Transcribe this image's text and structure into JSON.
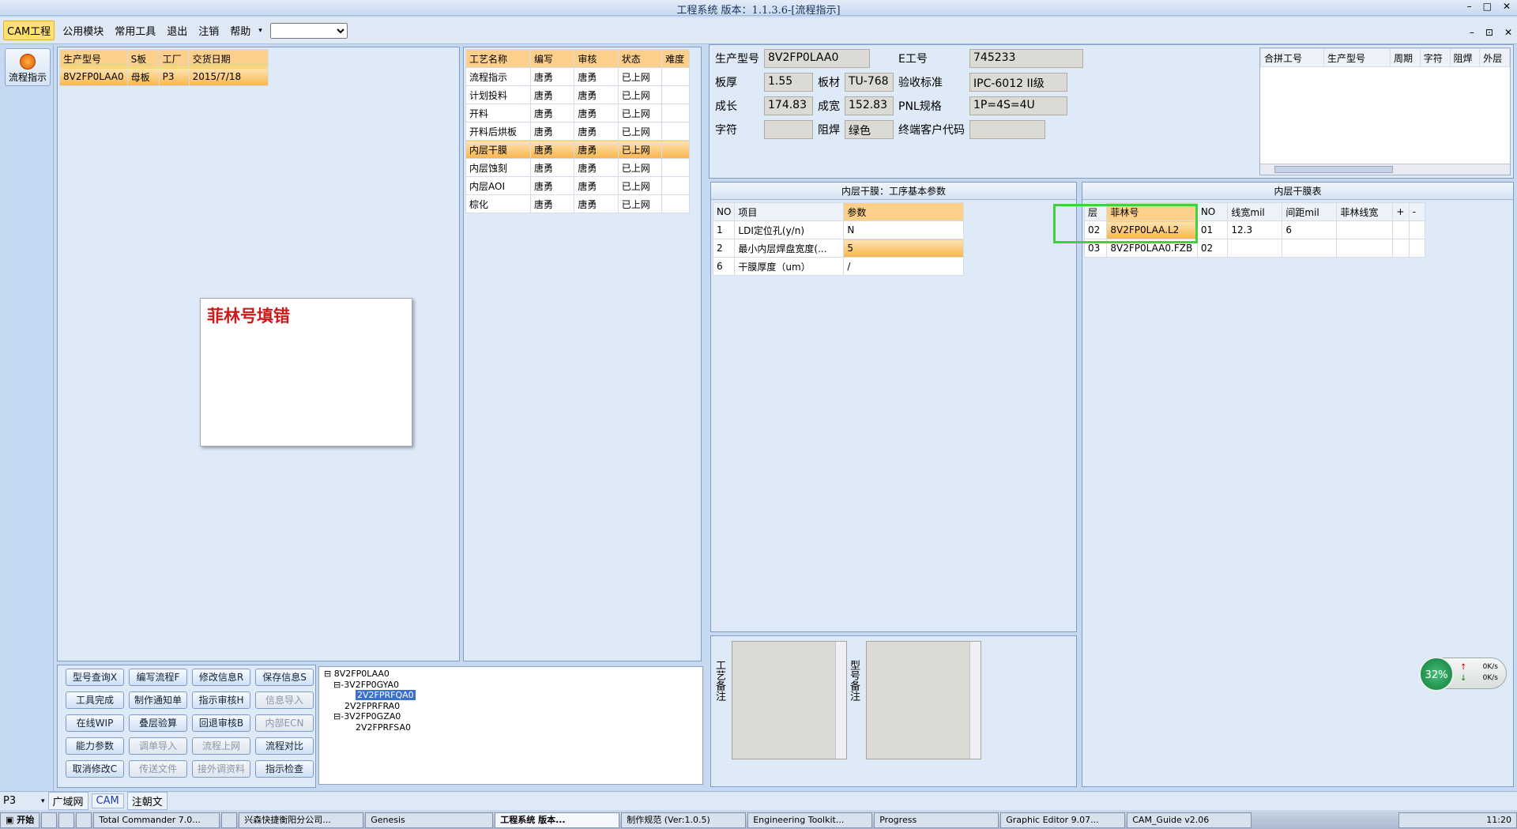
{
  "window": {
    "title": "工程系统  版本：1.1.3.6-[流程指示]",
    "controls": [
      "–",
      "□",
      "✕"
    ]
  },
  "menu": {
    "items": [
      "CAM工程",
      "公用模块",
      "常用工具",
      "退出",
      "注销",
      "帮助"
    ],
    "right": [
      "–",
      "⊡",
      "✕"
    ]
  },
  "side": {
    "flow_label": "流程指示"
  },
  "product_table": {
    "columns": [
      "生产型号",
      "S板",
      "工厂",
      "交货日期"
    ],
    "rows": [
      [
        "8V2FP0LAA0",
        "母板",
        "P3",
        "2015/7/18"
      ]
    ]
  },
  "popup": {
    "message": "菲林号填错"
  },
  "process_table": {
    "columns": [
      "工艺名称",
      "编写",
      "审核",
      "状态",
      "难度"
    ],
    "rows": [
      [
        "流程指示",
        "唐勇",
        "唐勇",
        "已上网",
        ""
      ],
      [
        "计划投料",
        "唐勇",
        "唐勇",
        "已上网",
        ""
      ],
      [
        "开料",
        "唐勇",
        "唐勇",
        "已上网",
        ""
      ],
      [
        "开料后烘板",
        "唐勇",
        "唐勇",
        "已上网",
        ""
      ],
      [
        "内层干膜",
        "唐勇",
        "唐勇",
        "已上网",
        ""
      ],
      [
        "内层蚀刻",
        "唐勇",
        "唐勇",
        "已上网",
        ""
      ],
      [
        "内层AOI",
        "唐勇",
        "唐勇",
        "已上网",
        ""
      ],
      [
        "棕化",
        "唐勇",
        "唐勇",
        "已上网",
        ""
      ]
    ]
  },
  "info": {
    "prod_label": "生产型号",
    "prod_value": "8V2FP0LAA0",
    "e_label": "E工号",
    "e_value": "745233",
    "thick_label": "板厚",
    "thick_value": "1.55",
    "mat_label": "板材",
    "mat_value": "TU-768",
    "std_label": "验收标准",
    "std_value": "IPC-6012 II级",
    "len_label": "成长",
    "len_value": "174.83",
    "wid_label": "成宽",
    "wid_value": "152.83",
    "pnl_label": "PNL规格",
    "pnl_value": "1P=4S=4U",
    "char_label": "字符",
    "char_value": "",
    "mask_label": "阻焊",
    "mask_value": "绿色",
    "cust_label": "终端客户代码",
    "cust_value": ""
  },
  "merge_table": {
    "columns": [
      "合拼工号",
      "生产型号",
      "周期",
      "字符",
      "阻焊",
      "外层"
    ]
  },
  "param_panel": {
    "title": "内层干膜：工序基本参数",
    "columns": [
      "NO",
      "项目",
      "参数"
    ],
    "rows": [
      [
        "1",
        "LDI定位孔(y/n)",
        "N"
      ],
      [
        "2",
        "最小内层焊盘宽度(...",
        "5"
      ],
      [
        "6",
        "干膜厚度（um）",
        "/"
      ]
    ]
  },
  "film_panel": {
    "title": "内层干膜表",
    "columns": [
      "层",
      "菲林号",
      "NO",
      "线宽mil",
      "间距mil",
      "菲林线宽",
      "+",
      "-"
    ],
    "rows": [
      [
        "02",
        "8V2FP0LAA.L2",
        "01",
        "12.3",
        "6",
        "",
        "",
        ""
      ],
      [
        "03",
        "8V2FP0LAA0.FZB",
        "02",
        "",
        "",
        "",
        "",
        ""
      ]
    ]
  },
  "buttons": [
    [
      "型号查询X",
      "编写流程F",
      "修改信息R",
      "保存信息S"
    ],
    [
      "工具完成",
      "制作通知单",
      "指示审核H",
      "信息导入"
    ],
    [
      "在线WIP",
      "叠层验算",
      "回退审核B",
      "内部ECN"
    ],
    [
      "能力参数",
      "调单导入",
      "流程上网",
      "流程对比"
    ],
    [
      "取消修改C",
      "传送文件",
      "接外调资料",
      "指示检查"
    ]
  ],
  "tree": {
    "root": "8V2FP0LAA0",
    "nodes": [
      "3V2FP0GYA0",
      "2V2FPRFQA0",
      "2V2FPRFRA0",
      "3V2FP0GZA0",
      "2V2FPRFSA0"
    ]
  },
  "remarks": {
    "process": "工艺备注",
    "model": "型号备注"
  },
  "net": {
    "percent": "32%",
    "up": "0K/s",
    "down": "0K/s"
  },
  "bottom": {
    "select": "P3",
    "tabs": [
      "广域网",
      "CAM",
      "注朝文"
    ]
  },
  "taskbar": {
    "start": "开始",
    "items": [
      "Total Commander 7.0...",
      "兴森快捷衡阳分公司...",
      "Genesis",
      "工程系统  版本...",
      "制作规范 (Ver:1.0.5)",
      "Engineering Toolkit...",
      "Progress",
      "Graphic Editor 9.07...",
      "CAM_Guide v2.06"
    ],
    "clock": "11:20"
  }
}
